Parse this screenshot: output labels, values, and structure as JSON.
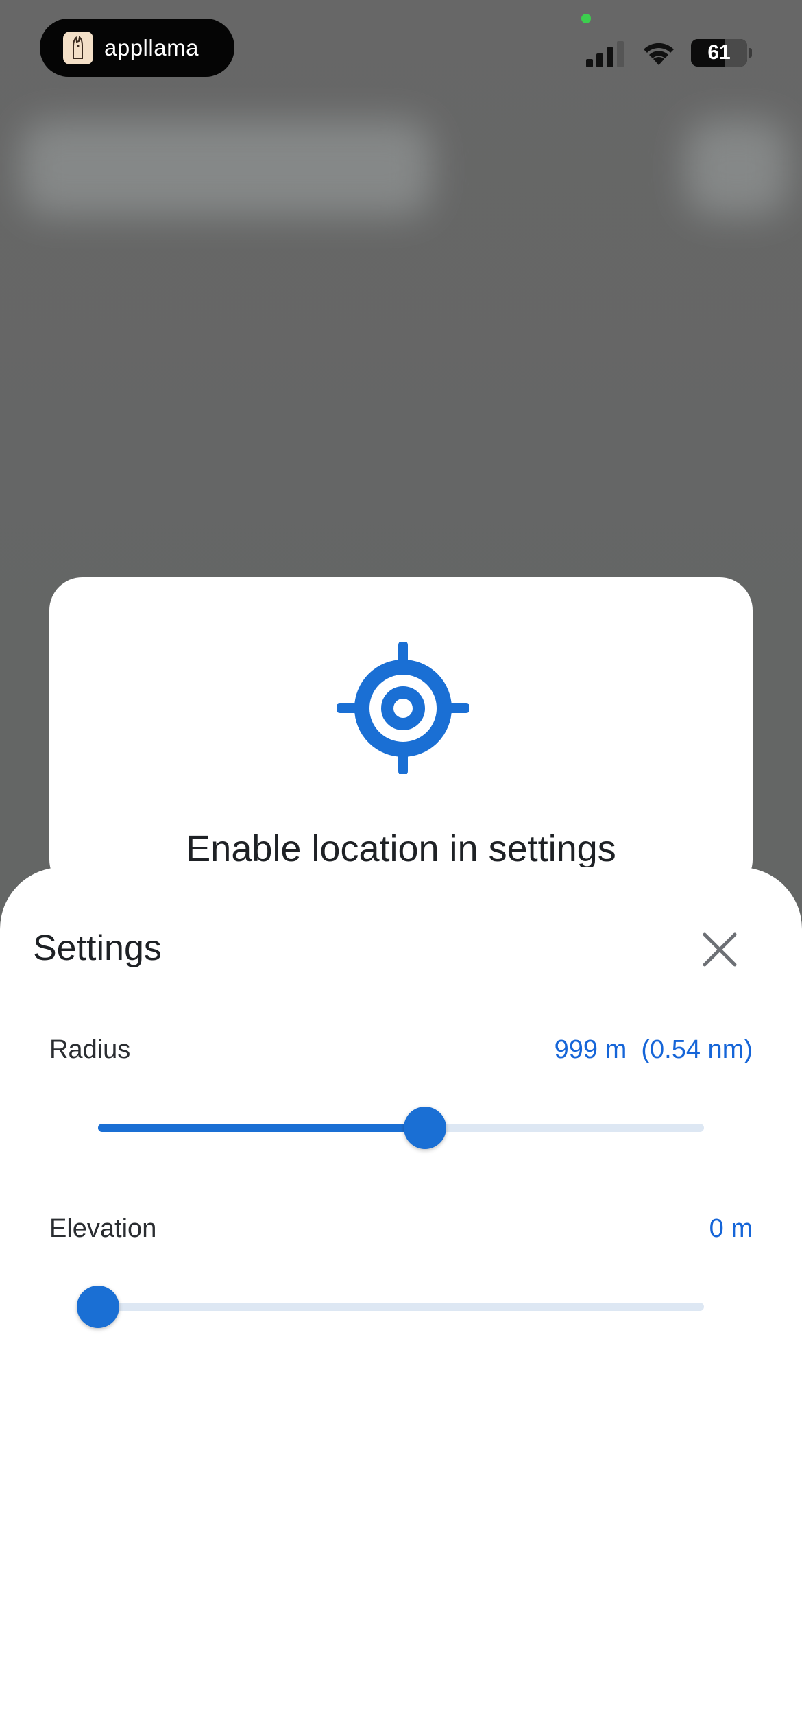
{
  "status_bar": {
    "app_pill_label": "appllama",
    "battery_level": "61",
    "battery_fraction": 0.61,
    "icons": [
      "llama-logo-icon",
      "cellular-signal-icon",
      "wifi-icon",
      "battery-icon"
    ]
  },
  "location_card": {
    "icon": "location-target-icon",
    "title": "Enable location in settings"
  },
  "settings_sheet": {
    "title": "Settings",
    "close_icon": "close-icon",
    "radius": {
      "label": "Radius",
      "value": "999 m  (0.54 nm)",
      "slider_fraction": 0.54
    },
    "elevation": {
      "label": "Elevation",
      "value": "0 m",
      "slider_fraction": 0.0
    }
  },
  "colors": {
    "accent": "#1a6fd4",
    "track": "#dde7f3",
    "overlay": "#646766"
  }
}
